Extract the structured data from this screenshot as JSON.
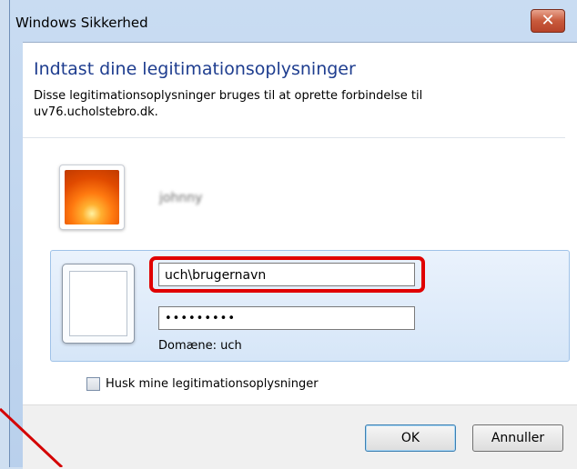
{
  "window": {
    "title": "Windows Sikkerhed",
    "close_glyph": "✕"
  },
  "dialog": {
    "heading": "Indtast dine legitimationsoplysninger",
    "description": "Disse legitimationsoplysninger bruges til at oprette forbindelse til uv76.ucholstebro.dk."
  },
  "saved_user": {
    "name": "johnny",
    "avatar_icon": "flower-avatar-icon"
  },
  "credentials": {
    "username_value": "uch\\brugernavn",
    "password_value": "•••••••••",
    "domain_text": "Domæne: uch"
  },
  "remember": {
    "label": "Husk mine legitimationsoplysninger",
    "checked": false
  },
  "buttons": {
    "ok_label": "OK",
    "cancel_label": "Annuller"
  },
  "colors": {
    "highlight": "#e00000",
    "heading": "#1e3d8f"
  }
}
